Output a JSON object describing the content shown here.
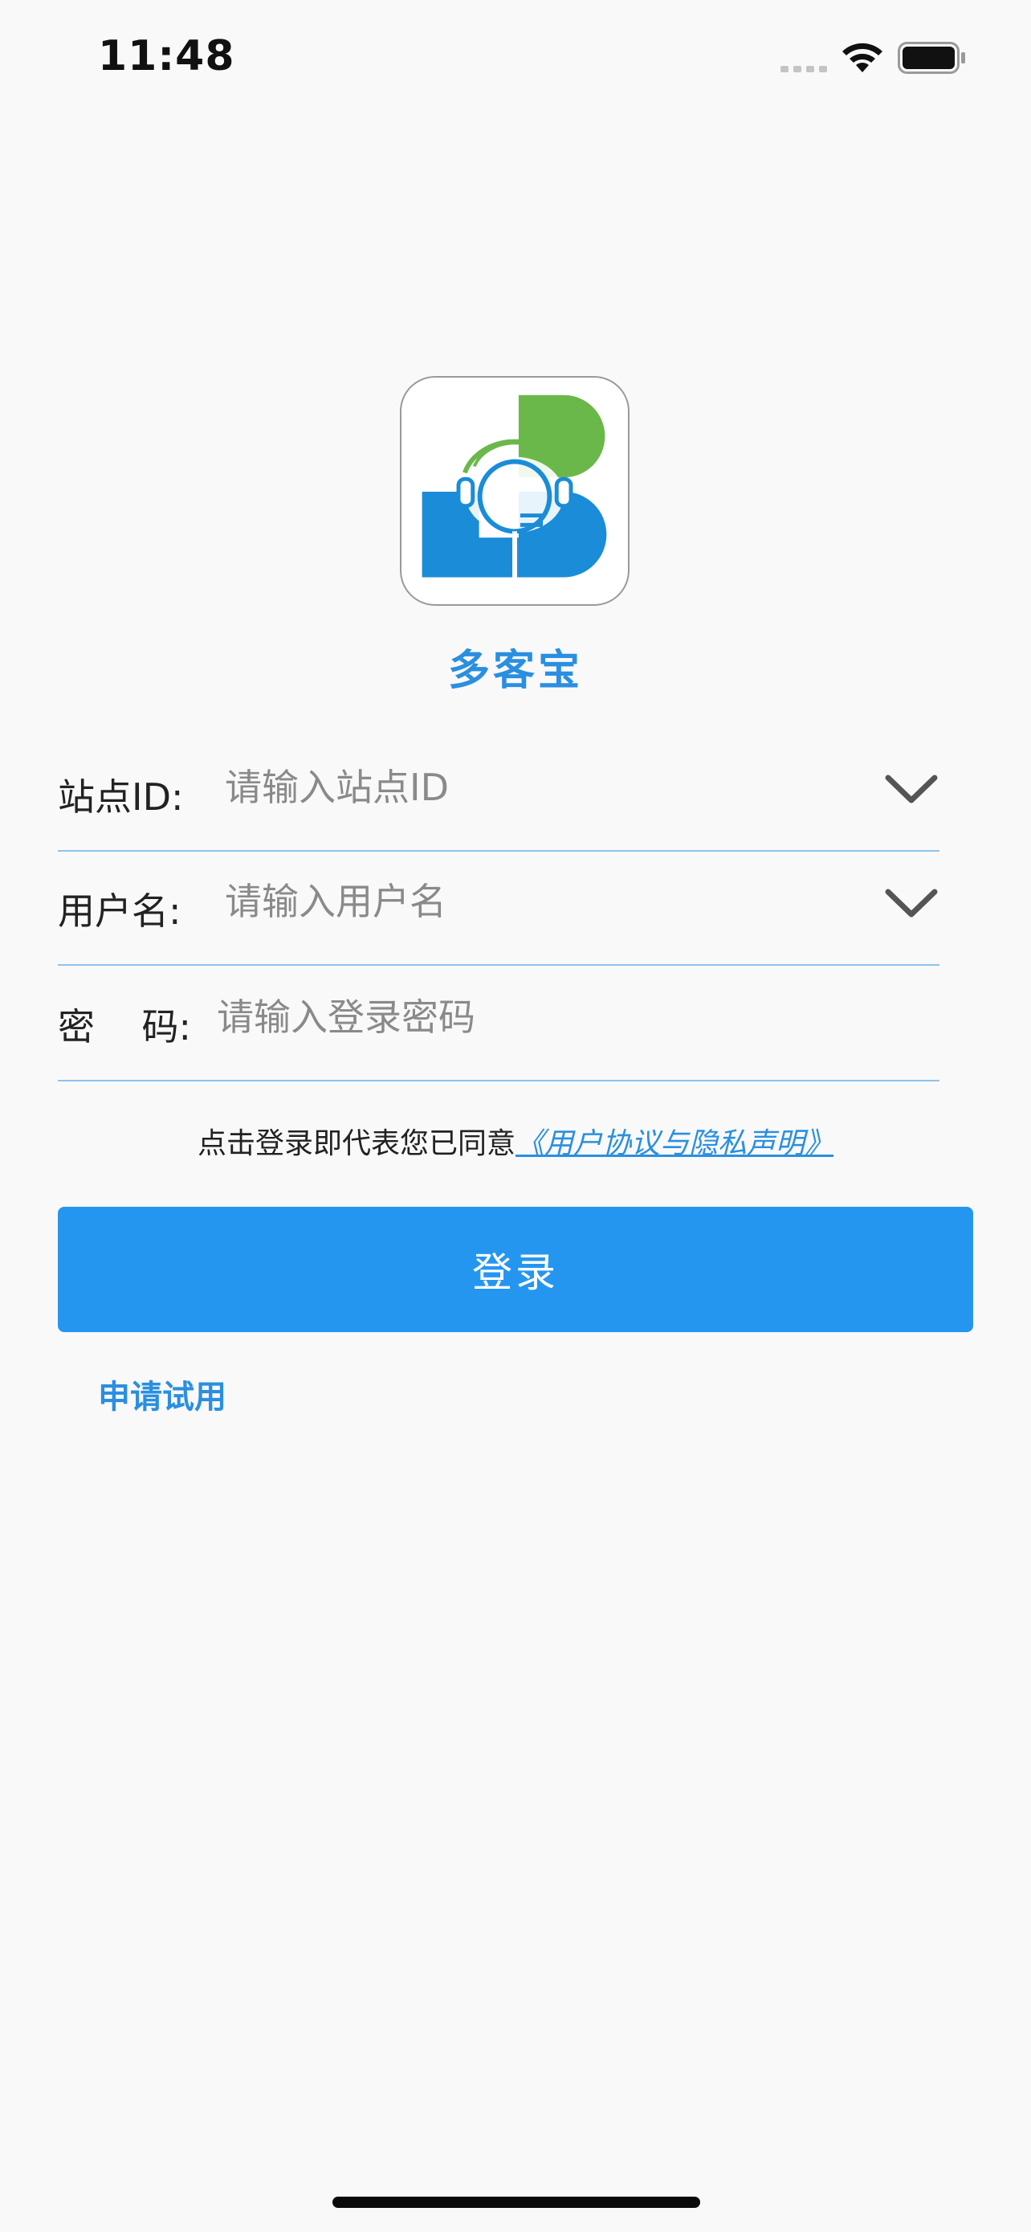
{
  "status_bar": {
    "time": "11:48",
    "signal_icon": "cellular-signal-icon",
    "wifi_icon": "wifi-icon",
    "battery_icon": "battery-icon"
  },
  "app": {
    "name": "多客宝",
    "logo_icon": "duokebao-logo",
    "brand_color": "#2a8fe0",
    "logo_green": "#6bb84a",
    "logo_blue": "#1a8cd8"
  },
  "form": {
    "site": {
      "label": "站点ID:",
      "placeholder": "请输入站点ID",
      "value": "",
      "dropdown_icon": "chevron-down-icon"
    },
    "username": {
      "label": "用户名:",
      "placeholder": "请输入用户名",
      "value": "",
      "dropdown_icon": "chevron-down-icon"
    },
    "password": {
      "label": "密    码:",
      "placeholder": "请输入登录密码",
      "value": ""
    }
  },
  "agreement": {
    "prefix": "点击登录即代表您已同意",
    "link": "《用户协议与隐私声明》"
  },
  "login_button": {
    "label": "登录",
    "color": "#2596f0"
  },
  "trial_link": {
    "label": "申请试用"
  }
}
